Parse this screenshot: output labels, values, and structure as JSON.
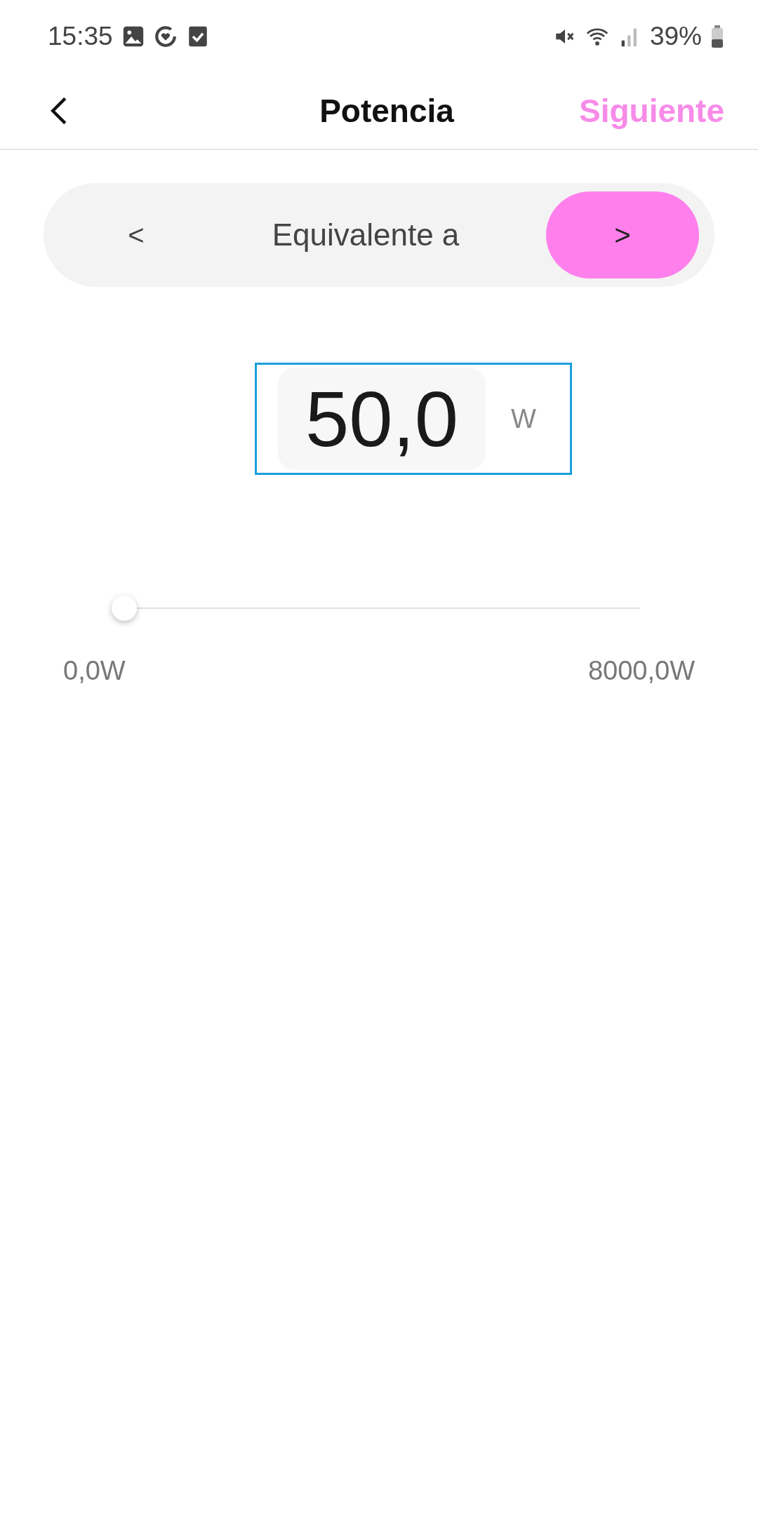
{
  "status_bar": {
    "time": "15:35",
    "battery": "39%"
  },
  "header": {
    "title": "Potencia",
    "action": "Siguiente"
  },
  "switcher": {
    "label": "Equivalente a",
    "buttons": [
      {
        "label": "<",
        "selected": false
      },
      {
        "label": ">",
        "selected": true
      }
    ]
  },
  "value_field": {
    "value": "50,0",
    "unit": "W"
  },
  "slider": {
    "level": 0.00625,
    "min_label": "0,0W",
    "max_label": "8000,0W"
  }
}
